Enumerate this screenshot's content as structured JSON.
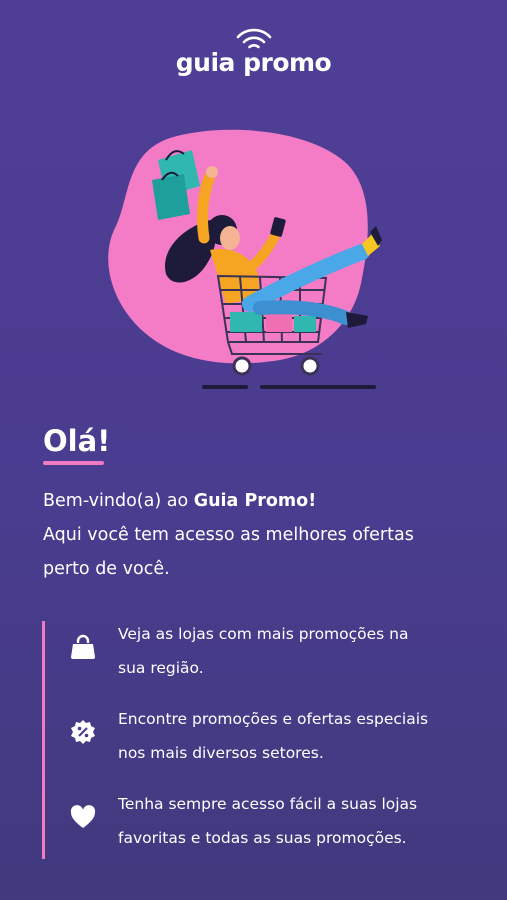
{
  "app": {
    "logo_text": "guia promo"
  },
  "welcome": {
    "greeting": "Olá!",
    "line1_prefix": "Bem-vindo(a) ao ",
    "line1_brand": "Guia Promo!",
    "line2": "Aqui você tem acesso as melhores ofertas",
    "line3": "perto de você."
  },
  "features": [
    {
      "icon": "shopping-bag-icon",
      "line1": "Veja as lojas com mais promoções na",
      "line2": "sua região."
    },
    {
      "icon": "discount-badge-icon",
      "line1": "Encontre promoções e ofertas especiais",
      "line2": "nos mais diversos setores."
    },
    {
      "icon": "heart-icon",
      "line1": "Tenha sempre acesso fácil a suas lojas",
      "line2": "favoritas e todas as suas promoções."
    }
  ],
  "colors": {
    "background": "#4f3e96",
    "accent_pink": "#f07bc2",
    "text": "#ffffff"
  }
}
